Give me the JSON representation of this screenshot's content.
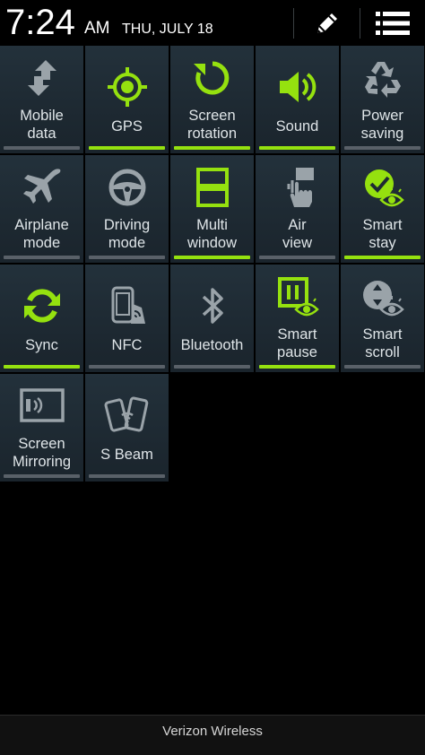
{
  "status": {
    "time": "7:24",
    "ampm": "AM",
    "date": "THU, JULY 18"
  },
  "header": {
    "edit_icon": "pencil-icon",
    "list_icon": "list-icon"
  },
  "colors": {
    "active": "#95e10f",
    "inactive_bar": "#596068",
    "icon_off": "#9aa3a9",
    "tile_bg": "#1e2a33"
  },
  "tiles": [
    {
      "id": "mobile-data",
      "line1": "Mobile",
      "line2": "data",
      "on": false,
      "icon": "mobile-data-icon"
    },
    {
      "id": "gps",
      "line1": "GPS",
      "line2": "",
      "on": true,
      "icon": "gps-icon"
    },
    {
      "id": "screen-rotation",
      "line1": "Screen",
      "line2": "rotation",
      "on": true,
      "icon": "rotation-icon"
    },
    {
      "id": "sound",
      "line1": "Sound",
      "line2": "",
      "on": true,
      "icon": "sound-icon"
    },
    {
      "id": "power-saving",
      "line1": "Power",
      "line2": "saving",
      "on": false,
      "icon": "recycle-icon"
    },
    {
      "id": "airplane-mode",
      "line1": "Airplane",
      "line2": "mode",
      "on": false,
      "icon": "airplane-icon"
    },
    {
      "id": "driving-mode",
      "line1": "Driving",
      "line2": "mode",
      "on": false,
      "icon": "steering-wheel-icon"
    },
    {
      "id": "multi-window",
      "line1": "Multi",
      "line2": "window",
      "on": true,
      "icon": "multi-window-icon"
    },
    {
      "id": "air-view",
      "line1": "Air",
      "line2": "view",
      "on": false,
      "icon": "air-view-icon"
    },
    {
      "id": "smart-stay",
      "line1": "Smart",
      "line2": "stay",
      "on": true,
      "icon": "smart-stay-icon"
    },
    {
      "id": "sync",
      "line1": "Sync",
      "line2": "",
      "on": true,
      "icon": "sync-icon"
    },
    {
      "id": "nfc",
      "line1": "NFC",
      "line2": "",
      "on": false,
      "icon": "nfc-icon"
    },
    {
      "id": "bluetooth",
      "line1": "Bluetooth",
      "line2": "",
      "on": false,
      "icon": "bluetooth-icon"
    },
    {
      "id": "smart-pause",
      "line1": "Smart",
      "line2": "pause",
      "on": true,
      "icon": "smart-pause-icon"
    },
    {
      "id": "smart-scroll",
      "line1": "Smart",
      "line2": "scroll",
      "on": false,
      "icon": "smart-scroll-icon"
    },
    {
      "id": "screen-mirroring",
      "line1": "Screen",
      "line2": "Mirroring",
      "on": false,
      "icon": "screen-mirroring-icon"
    },
    {
      "id": "s-beam",
      "line1": "S Beam",
      "line2": "",
      "on": false,
      "icon": "s-beam-icon"
    }
  ],
  "carrier": "Verizon Wireless"
}
